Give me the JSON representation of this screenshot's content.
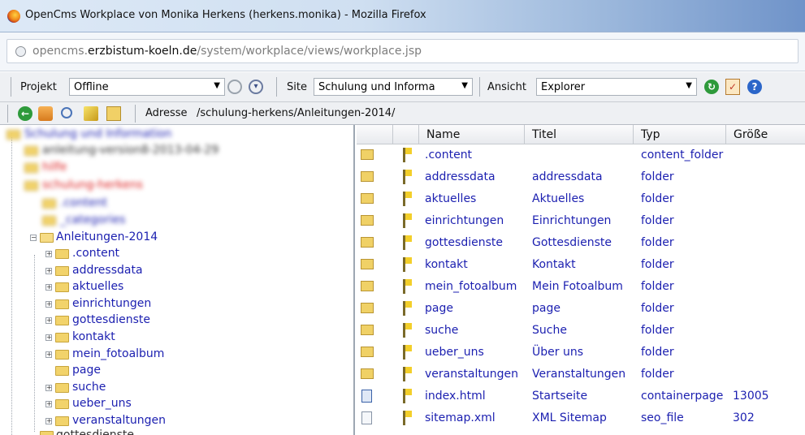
{
  "window": {
    "title": "OpenCms Workplace von Monika Herkens (herkens.monika) - Mozilla Firefox"
  },
  "urlbar": {
    "prefix": "opencms.",
    "domain": "erzbistum-koeln.de",
    "path": "/system/workplace/views/workplace.jsp"
  },
  "toolbar1": {
    "projekt_label": "Projekt",
    "projekt_value": "Offline",
    "site_label": "Site",
    "site_value": "Schulung und Informa",
    "ansicht_label": "Ansicht",
    "ansicht_value": "Explorer"
  },
  "toolbar2": {
    "address_label": "Adresse",
    "address_value": "/schulung-herkens/Anleitungen-2014/"
  },
  "tree": {
    "blurred": [
      "Schulung und Information",
      "anleitung-version8-2013-04-29",
      "hilfe",
      "schulung-herkens",
      ".content",
      "_categories"
    ],
    "current": "Anleitungen-2014",
    "children": [
      ".content",
      "addressdata",
      "aktuelles",
      "einrichtungen",
      "gottesdienste",
      "kontakt",
      "mein_fotoalbum",
      "page",
      "suche",
      "ueber_uns",
      "veranstaltungen"
    ],
    "bottom": "gottesdienste"
  },
  "list": {
    "columns": [
      "Name",
      "Titel",
      "Typ",
      "Größe"
    ],
    "rows": [
      {
        "name": ".content",
        "title": "",
        "type": "content_folder",
        "size": "",
        "icon": "content-folder-icon"
      },
      {
        "name": "addressdata",
        "title": "addressdata",
        "type": "folder",
        "size": "",
        "icon": "folder-icon"
      },
      {
        "name": "aktuelles",
        "title": "Aktuelles",
        "type": "folder",
        "size": "",
        "icon": "folder-icon"
      },
      {
        "name": "einrichtungen",
        "title": "Einrichtungen",
        "type": "folder",
        "size": "",
        "icon": "folder-icon"
      },
      {
        "name": "gottesdienste",
        "title": "Gottesdienste",
        "type": "folder",
        "size": "",
        "icon": "folder-icon"
      },
      {
        "name": "kontakt",
        "title": "Kontakt",
        "type": "folder",
        "size": "",
        "icon": "folder-icon"
      },
      {
        "name": "mein_fotoalbum",
        "title": "Mein Fotoalbum",
        "type": "folder",
        "size": "",
        "icon": "folder-icon"
      },
      {
        "name": "page",
        "title": "page",
        "type": "folder",
        "size": "",
        "icon": "folder-icon"
      },
      {
        "name": "suche",
        "title": "Suche",
        "type": "folder",
        "size": "",
        "icon": "folder-icon"
      },
      {
        "name": "ueber_uns",
        "title": "Über uns",
        "type": "folder",
        "size": "",
        "icon": "folder-icon"
      },
      {
        "name": "veranstaltungen",
        "title": "Veranstaltungen",
        "type": "folder",
        "size": "",
        "icon": "folder-icon"
      },
      {
        "name": "index.html",
        "title": "Startseite",
        "type": "containerpage",
        "size": "13005",
        "icon": "containerpage-icon"
      },
      {
        "name": "sitemap.xml",
        "title": "XML Sitemap",
        "type": "seo_file",
        "size": "302",
        "icon": "document-icon"
      }
    ]
  }
}
